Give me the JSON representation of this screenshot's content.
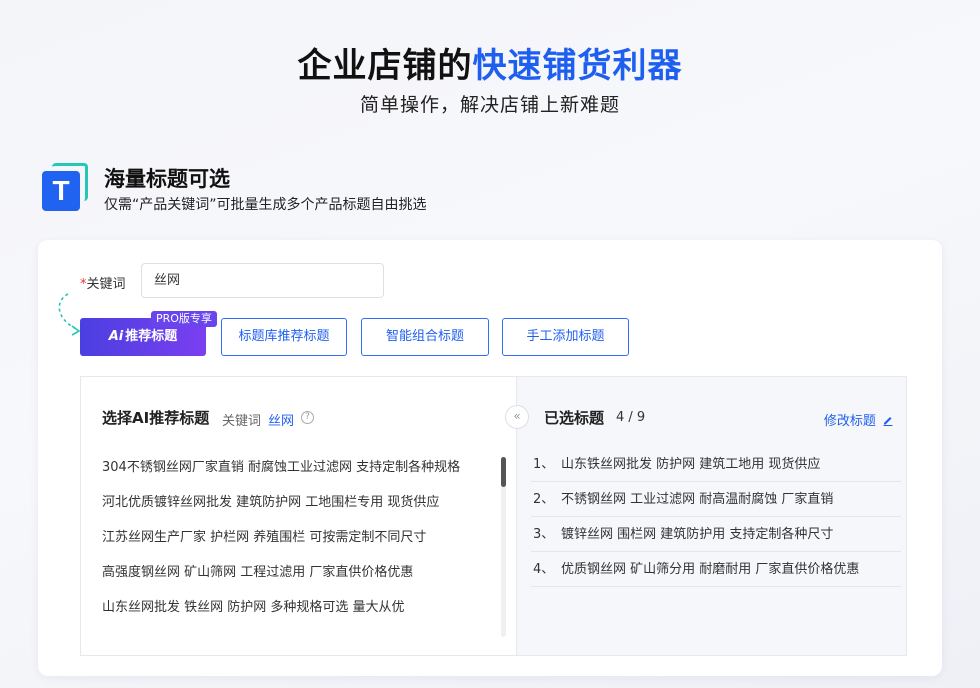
{
  "hero": {
    "title_main": "企业店铺的",
    "title_highlight": "快速铺货利器",
    "subtitle": "简单操作，解决店铺上新难题"
  },
  "feature": {
    "icon_letter": "T",
    "title": "海量标题可选",
    "desc": "仅需“产品关键词”可批量生成多个产品标题自由挑选"
  },
  "form": {
    "keyword_required_mark": "*",
    "keyword_label": "关键词",
    "keyword_value": "丝网"
  },
  "buttons": {
    "ai_mark": "Ai",
    "ai_label": "推荐标题",
    "pro_badge": "PRO版专享",
    "library": "标题库推荐标题",
    "smart": "智能组合标题",
    "manual": "手工添加标题"
  },
  "left_panel": {
    "title": "选择AI推荐标题",
    "keyword_label": "关键词",
    "keyword_value": "丝网",
    "help": "?",
    "items": [
      "304不锈钢丝网厂家直销 耐腐蚀工业过滤网 支持定制各种规格",
      "河北优质镀锌丝网批发 建筑防护网 工地围栏专用 现货供应",
      "江苏丝网生产厂家 护栏网 养殖围栏 可按需定制不同尺寸",
      "高强度钢丝网 矿山筛网 工程过滤用 厂家直供价格优惠",
      "山东丝网批发 铁丝网 防护网 多种规格可选 量大从优"
    ]
  },
  "right_panel": {
    "collapse": "«",
    "title": "已选标题",
    "count": "4 / 9",
    "edit_label": "修改标题",
    "items": [
      {
        "num": "1、",
        "text": "山东铁丝网批发 防护网 建筑工地用 现货供应"
      },
      {
        "num": "2、",
        "text": "不锈钢丝网 工业过滤网 耐高温耐腐蚀 厂家直销"
      },
      {
        "num": "3、",
        "text": "镀锌丝网 围栏网 建筑防护用 支持定制各种尺寸"
      },
      {
        "num": "4、",
        "text": "优质钢丝网 矿山筛分用 耐磨耐用 厂家直供价格优惠"
      }
    ]
  },
  "colors": {
    "accent": "#1f5ff0",
    "ai_gradient_start": "#4b3fe0",
    "ai_gradient_end": "#7a3ff0",
    "teal": "#26c6b8"
  }
}
